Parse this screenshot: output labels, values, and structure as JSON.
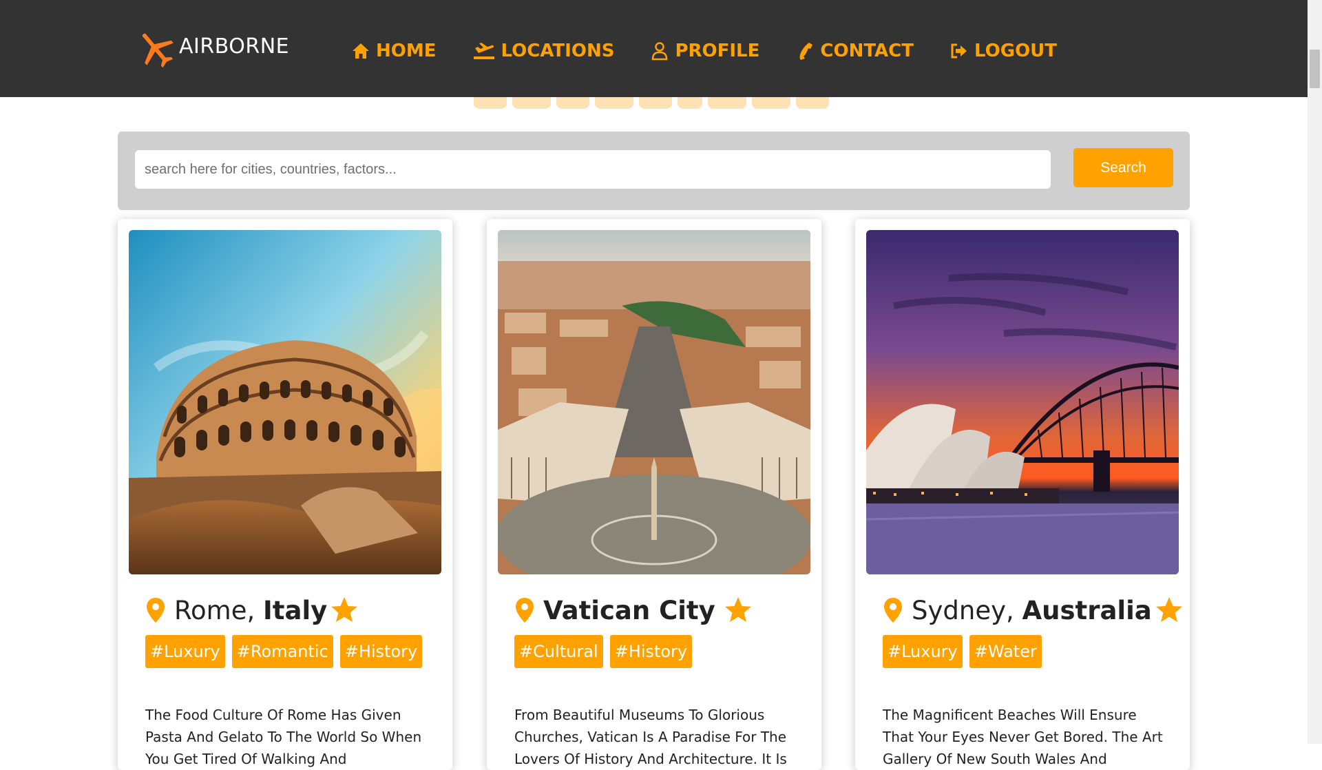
{
  "brand": {
    "name": "AIRBORNE",
    "accent": "#FFA200",
    "navbar_bg": "#333333"
  },
  "nav": [
    {
      "label": "HOME",
      "icon": "home-icon"
    },
    {
      "label": "LOCATIONS",
      "icon": "plane-landing-icon"
    },
    {
      "label": "PROFILE",
      "icon": "user-icon"
    },
    {
      "label": "CONTACT",
      "icon": "phone-icon"
    },
    {
      "label": "LOGOUT",
      "icon": "logout-icon"
    }
  ],
  "search": {
    "placeholder": "search here for cities, countries, factors...",
    "value": "",
    "button_label": "Search"
  },
  "cards": [
    {
      "city": "Rome,",
      "country": "Italy",
      "tags": [
        "#Luxury",
        "#Romantic",
        "#History"
      ],
      "description": "The Food Culture Of Rome Has Given Pasta And Gelato To The World So When You Get Tired Of Walking And"
    },
    {
      "city": "",
      "country": "Vatican City",
      "tags": [
        "#Cultural",
        "#History"
      ],
      "description": "From Beautiful Museums To Glorious Churches, Vatican Is A Paradise For The Lovers Of History And Architecture. It Is"
    },
    {
      "city": "Sydney,",
      "country": "Australia",
      "tags": [
        "#Luxury",
        "#Water"
      ],
      "description": "The Magnificent Beaches Will Ensure That Your Eyes Never Get Bored. The Art Gallery Of New South Wales And"
    }
  ]
}
